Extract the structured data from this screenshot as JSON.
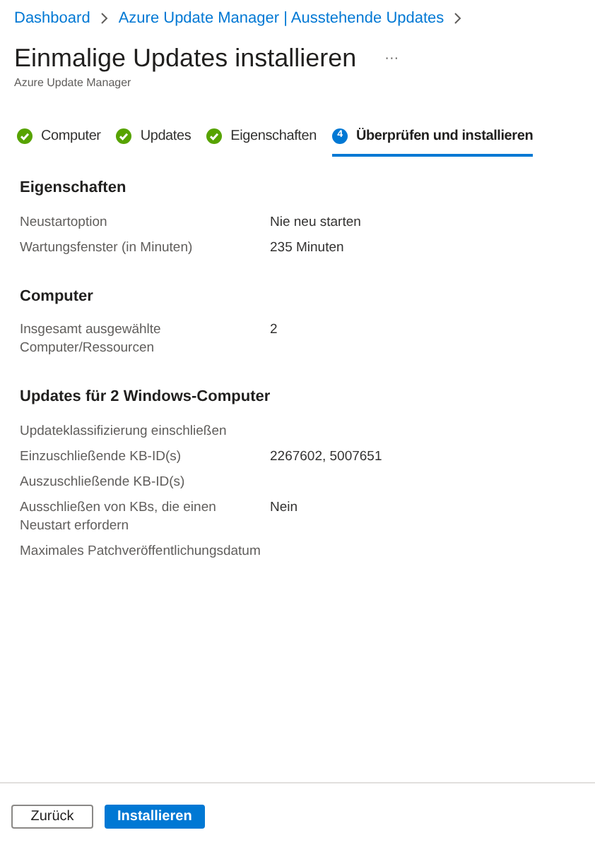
{
  "breadcrumb": [
    "Dashboard",
    "Azure Update Manager | Ausstehende Updates"
  ],
  "title": "Einmalige Updates installieren",
  "more": "···",
  "subtitle": "Azure Update Manager",
  "tabs": [
    {
      "label": "Computer",
      "selected": false,
      "completed": true
    },
    {
      "label": "Updates",
      "selected": false,
      "completed": true
    },
    {
      "label": "Eigenschaften",
      "selected": false,
      "completed": true
    },
    {
      "label": "Überprüfen und installieren",
      "selected": true,
      "completed": false,
      "step": "4"
    }
  ],
  "sections": [
    {
      "heading": "Eigenschaften",
      "rows": [
        {
          "label": "Neustartoption",
          "value": "Nie neu starten"
        },
        {
          "label": "Wartungsfenster (in Minuten)",
          "value": "235 Minuten"
        }
      ]
    },
    {
      "heading": "Computer",
      "rows": [
        {
          "label": "Insgesamt ausgewählte Computer/Ressourcen",
          "value": "2"
        }
      ]
    },
    {
      "heading": "Updates für 2 Windows-Computer",
      "rows": [
        {
          "label": "Updateklassifizierung einschließen"
        },
        {
          "label": "Einzuschließende KB-ID(s)",
          "value": "2267602, 5007651"
        },
        {
          "label": "Auszuschließende KB-ID(s)"
        },
        {
          "label": "Ausschließen von KBs, die einen Neustart erfordern",
          "value": "Nein"
        },
        {
          "label": "Maximales Patchveröffentlichungsdatum"
        }
      ]
    }
  ],
  "buttons": [
    {
      "label": "Zurück",
      "kind": "secondary"
    },
    {
      "label": "Installieren",
      "kind": "primary"
    }
  ]
}
